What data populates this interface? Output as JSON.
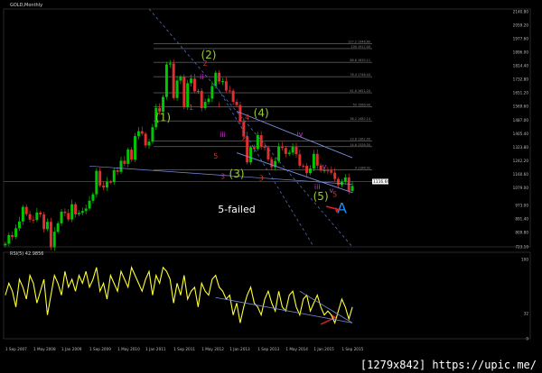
{
  "chart_data": [
    {
      "type": "candlestick",
      "title": "GOLD,Monthly",
      "x_start": "2007-09",
      "period": "1 month",
      "ylim": [
        723.1,
        2156.0
      ],
      "grid": false,
      "ticks_y": [
        "2140.80",
        "2059.20",
        "1977.60",
        "1896.00",
        "1814.40",
        "1732.80",
        "1651.20",
        "1569.60",
        "1487.00",
        "1405.40",
        "1323.80",
        "1242.20",
        "1160.60",
        "1079.00",
        "973.00",
        "891.40",
        "809.80",
        "723.10"
      ],
      "current_price": "1116.66",
      "closes": [
        742,
        794,
        783,
        835,
        876,
        964,
        920,
        887,
        885,
        930,
        918,
        830,
        874,
        719,
        814,
        865,
        935,
        927,
        888,
        980,
        919,
        928,
        939,
        954,
        1001,
        1040,
        1181,
        1093,
        1081,
        1115,
        1113,
        1185,
        1175,
        1242,
        1223,
        1309,
        1249,
        1390,
        1420,
        1405,
        1334,
        1357,
        1444,
        1560,
        1538,
        1626,
        1822,
        1828,
        1620,
        1725,
        1747,
        1564,
        1709,
        1737,
        1660,
        1663,
        1559,
        1597,
        1616,
        1692,
        1772,
        1719,
        1721,
        1665,
        1664,
        1597,
        1577,
        1477,
        1390,
        1232,
        1323,
        1313,
        1396,
        1325,
        1322,
        1250,
        1204,
        1240,
        1327,
        1319,
        1283,
        1291,
        1327,
        1281,
        1212,
        1211,
        1167,
        1195,
        1283,
        1213,
        1182,
        1184,
        1183,
        1170,
        1132,
        1095,
        1115,
        1141,
        1060,
        1090
      ],
      "fib_levels": [
        {
          "label": "127.2  1946.80",
          "value": 1946.8
        },
        {
          "label": "100  1917.40",
          "value": 1917.4
        },
        {
          "label": "88.6  1835.11",
          "value": 1835.1
        },
        {
          "label": "76.4  1748.44",
          "value": 1748.4
        },
        {
          "label": "61.8  1651.20",
          "value": 1651.2
        },
        {
          "label": "50  1566.40",
          "value": 1566.4
        },
        {
          "label": "38.2  1482.14",
          "value": 1482.1
        },
        {
          "label": "23.6  1362.00",
          "value": 1362.0
        },
        {
          "label": "14.6  1326.50",
          "value": 1326.5
        },
        {
          "label": "0  1186.02",
          "value": 1186.0
        }
      ],
      "wave_labels": [
        {
          "text": "(2)",
          "color": "#9acd32",
          "x": 1,
          "y": 1858
        },
        {
          "text": "(1)",
          "color": "#9acd32",
          "x": 1,
          "y": 1479
        },
        {
          "text": "(4)",
          "color": "#9acd32",
          "x": 1,
          "y": 1508
        },
        {
          "text": "(3)",
          "color": "#9acd32",
          "x": 1,
          "y": 1140
        },
        {
          "text": "(5)",
          "color": "#9acd32",
          "x": 1,
          "y": 1005
        },
        {
          "text": "5-failed",
          "color": "#ffffff",
          "x": 1,
          "y": 928
        },
        {
          "text": "A",
          "color": "#1e90ff",
          "x": 1,
          "y": 926
        },
        {
          "text": "ii",
          "color": "#cc33cc",
          "x": 1,
          "y": 1733
        },
        {
          "text": "iii",
          "color": "#cc33cc",
          "x": 1,
          "y": 1386
        },
        {
          "text": "iv",
          "color": "#cc33cc",
          "x": 1,
          "y": 1388
        },
        {
          "text": "v",
          "color": "#cc33cc",
          "x": 1,
          "y": 1193
        },
        {
          "text": "iii",
          "color": "#cc33cc",
          "x": 1,
          "y": 1071
        },
        {
          "text": "v",
          "color": "#cc33cc",
          "x": 1,
          "y": 1049
        },
        {
          "text": "1",
          "color": "#e03030",
          "x": 1,
          "y": 1549
        },
        {
          "text": "2",
          "color": "#e03030",
          "x": 1,
          "y": 1814
        },
        {
          "text": "3",
          "color": "#e03030",
          "x": 1,
          "y": 1133
        },
        {
          "text": "4",
          "color": "#e03030",
          "x": 1,
          "y": 1488
        },
        {
          "text": "5",
          "color": "#e03030",
          "x": 1,
          "y": 1255
        },
        {
          "text": "1",
          "color": "#e03030",
          "x": 1,
          "y": 1225
        },
        {
          "text": "2",
          "color": "#e03030",
          "x": 1,
          "y": 1360
        },
        {
          "text": "3",
          "color": "#e03030",
          "x": 1,
          "y": 1123
        },
        {
          "text": "5",
          "color": "#e03030",
          "x": 1,
          "y": 1024
        },
        {
          "text": "i",
          "color": "#e03030",
          "x": 1,
          "y": 1565
        }
      ],
      "colors": {
        "bull": "#00c800",
        "bear": "#e03030",
        "fib": "#9a9a9a",
        "wedge": "#7b8cde",
        "trend": "#4f6cc4",
        "arrow": "#e02020"
      }
    },
    {
      "type": "line",
      "title": "RSI(5) 42.9856",
      "ylim": [
        0,
        100
      ],
      "ticks_y": [
        "100",
        "32",
        "0"
      ],
      "values": [
        55,
        70,
        60,
        40,
        75,
        65,
        50,
        80,
        70,
        45,
        60,
        75,
        30,
        55,
        80,
        70,
        55,
        85,
        65,
        75,
        60,
        80,
        70,
        85,
        65,
        75,
        90,
        60,
        70,
        50,
        80,
        70,
        60,
        85,
        75,
        65,
        90,
        80,
        70,
        60,
        75,
        85,
        55,
        80,
        70,
        90,
        85,
        75,
        45,
        70,
        55,
        80,
        50,
        60,
        65,
        40,
        70,
        60,
        55,
        75,
        80,
        65,
        60,
        50,
        55,
        30,
        45,
        20,
        40,
        55,
        65,
        45,
        40,
        30,
        50,
        60,
        45,
        35,
        60,
        40,
        35,
        55,
        60,
        40,
        30,
        50,
        55,
        35,
        45,
        55,
        40,
        30,
        35,
        30,
        20,
        35,
        50,
        40,
        25,
        40
      ],
      "color": "#ffff33"
    }
  ],
  "x_axis_labels": [
    "1 Sep 2007",
    "1 May 2008",
    "1 Jan 2009",
    "1 Sep 2009",
    "1 May 2010",
    "1 Jan 2011",
    "1 Sep 2011",
    "1 May 2012",
    "1 Jan 2013",
    "1 Sep 2013",
    "1 May 2014",
    "1 Jan 2015",
    "1 Sep 2015"
  ],
  "watermark": "[1279x842] https://upic.me/"
}
